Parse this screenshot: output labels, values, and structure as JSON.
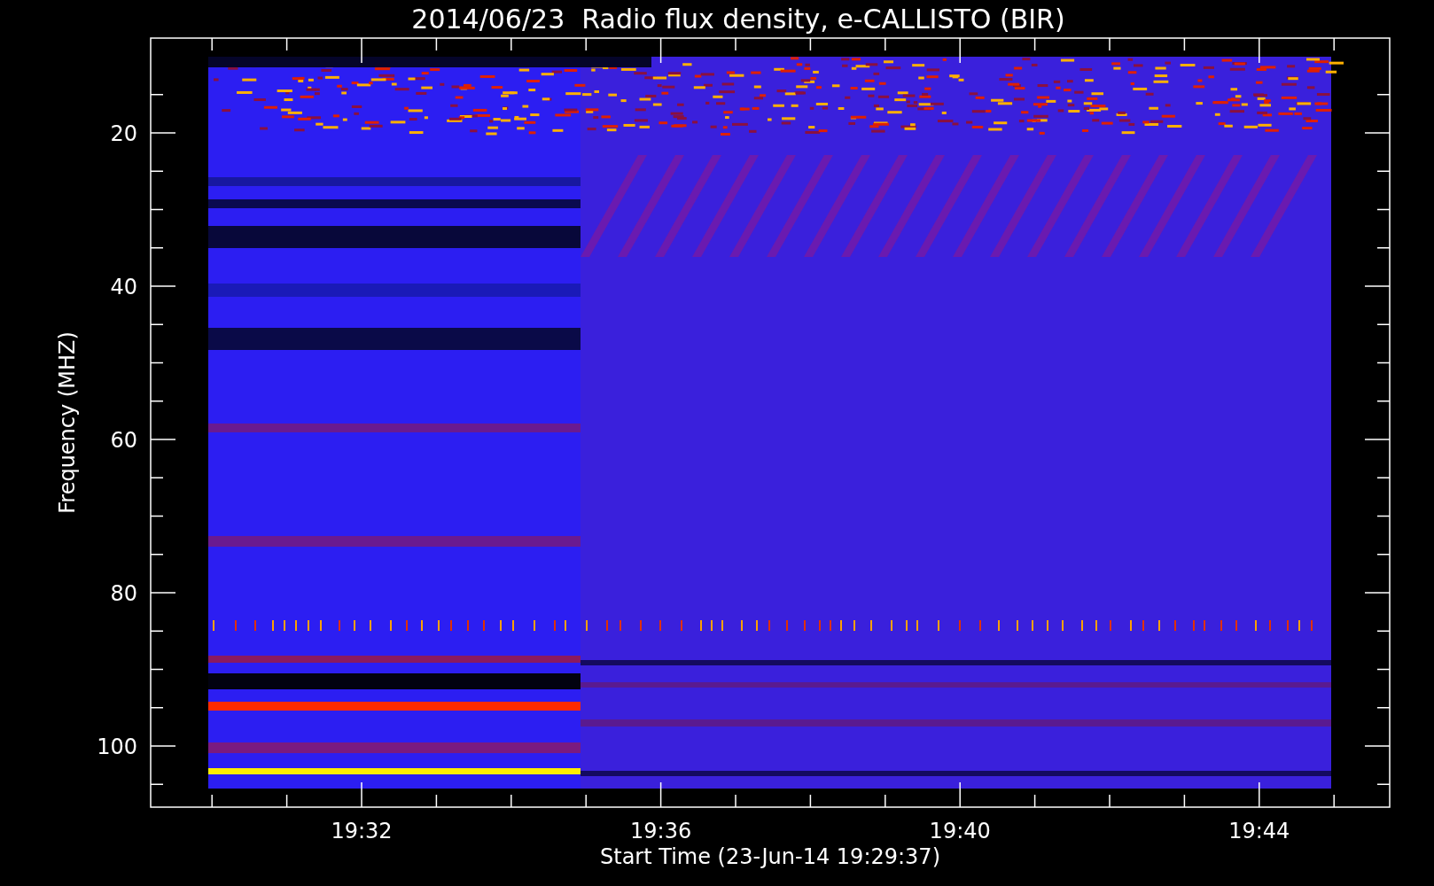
{
  "title": "2014/06/23  Radio flux density, e-CALLISTO (BIR)",
  "y_axis": {
    "label": "Frequency (MHZ)",
    "ticks": [
      "20",
      "40",
      "60",
      "80",
      "100"
    ]
  },
  "x_axis": {
    "label": "Start Time (23-Jun-14 19:29:37)",
    "ticks": [
      "19:32",
      "19:36",
      "19:40",
      "19:44"
    ]
  }
}
